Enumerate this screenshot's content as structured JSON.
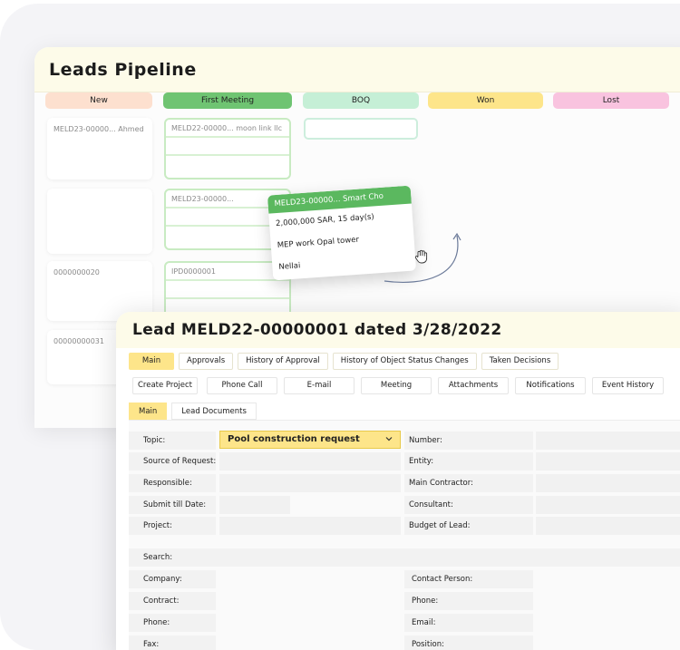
{
  "pipeline": {
    "title": "Leads Pipeline",
    "columns": [
      {
        "label": "New",
        "color": "#fde0cf"
      },
      {
        "label": "First Meeting",
        "color": "#6fc472"
      },
      {
        "label": "BOQ",
        "color": "#c5efd6"
      },
      {
        "label": "Won",
        "color": "#fde58a"
      },
      {
        "label": "Lost",
        "color": "#f9c3df"
      }
    ],
    "new_cards": [
      "MELD23-00000... Ahmed",
      "",
      "0000000020",
      "00000000031"
    ],
    "meeting_cards": [
      "MELD22-00000... moon link llc",
      "MELD23-00000...",
      "IPD0000001"
    ],
    "drag_card": {
      "header": "MELD23-00000... Smart Cho",
      "lines": [
        "2,000,000 SAR, 15 day(s)",
        "MEP work Opal tower",
        "Nellai"
      ]
    }
  },
  "lead": {
    "title": "Lead MELD22-00000001 dated 3/28/2022",
    "tabs": [
      "Main",
      "Approvals",
      "History of Approval",
      "History of Object Status Changes",
      "Taken Decisions"
    ],
    "actions": [
      "Create Project",
      "Phone Call",
      "E-mail",
      "Meeting",
      "Attachments",
      "Notifications",
      "Event History"
    ],
    "subtabs": [
      "Main",
      "Lead Documents"
    ],
    "form": {
      "topic_label": "Topic:",
      "topic_value": "Pool construction request",
      "source_label": "Source of Request:",
      "responsible_label": "Responsible:",
      "submit_label": "Submit till Date:",
      "project_label": "Project:",
      "number_label": "Number:",
      "entity_label": "Entity:",
      "main_contractor_label": "Main Contractor:",
      "consultant_label": "Consultant:",
      "budget_label": "Budget of Lead:",
      "search_label": "Search:",
      "company_label": "Company:",
      "contract_label": "Contract:",
      "phone_label": "Phone:",
      "fax_label": "Fax:",
      "contact_person_label": "Contact Person:",
      "phone2_label": "Phone:",
      "email_label": "Email:",
      "position_label": "Position:"
    }
  }
}
